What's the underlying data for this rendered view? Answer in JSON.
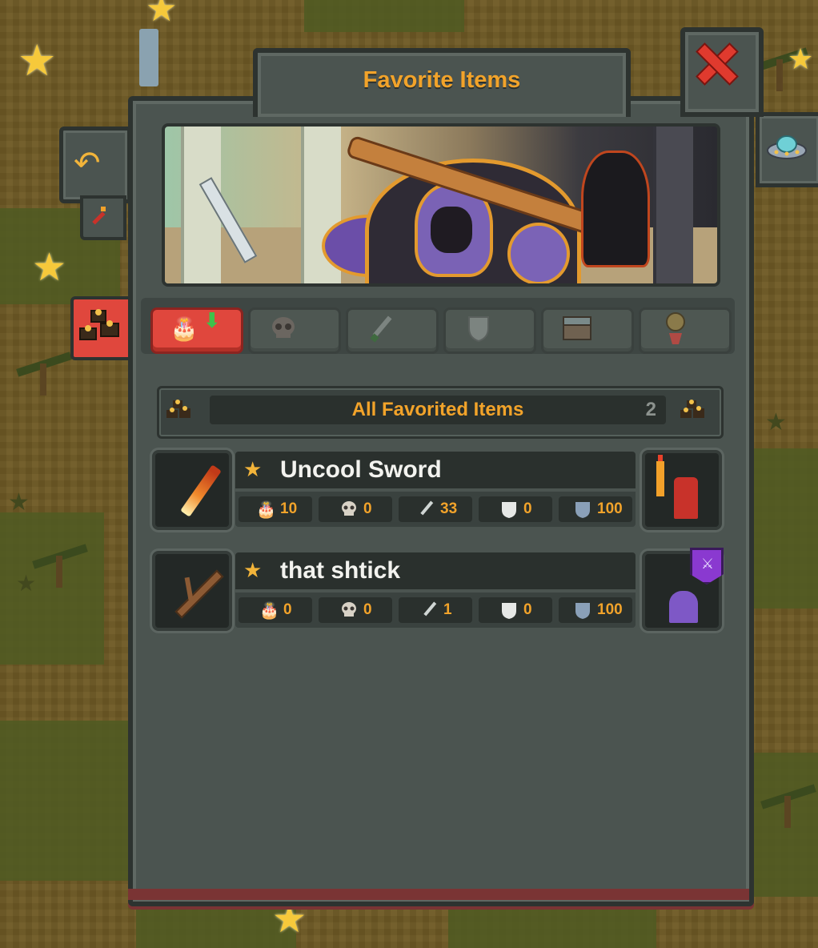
{
  "dialog": {
    "title": "Favorite Items"
  },
  "header": {
    "close_icon": "close-x-icon",
    "back_icon": "back-arrow-icon"
  },
  "category_tabs": [
    {
      "icon": "cake-icon",
      "active": true
    },
    {
      "icon": "skull-icon",
      "active": false
    },
    {
      "icon": "sword-icon",
      "active": false
    },
    {
      "icon": "shield-icon",
      "active": false
    },
    {
      "icon": "chest-icon",
      "active": false
    },
    {
      "icon": "trinket-icon",
      "active": false
    }
  ],
  "list": {
    "title": "All Favorited Items",
    "count": "2"
  },
  "items": [
    {
      "name": "Uncool Sword",
      "stats": {
        "cake": "10",
        "skull": "0",
        "sword": "33",
        "shield": "0",
        "armor": "100"
      }
    },
    {
      "name": "that shtick",
      "stats": {
        "cake": "0",
        "skull": "0",
        "sword": "1",
        "shield": "0",
        "armor": "100"
      }
    }
  ],
  "colors": {
    "accent": "#f2a32a",
    "active_tab": "#e0473d",
    "panel": "#4b5450"
  }
}
